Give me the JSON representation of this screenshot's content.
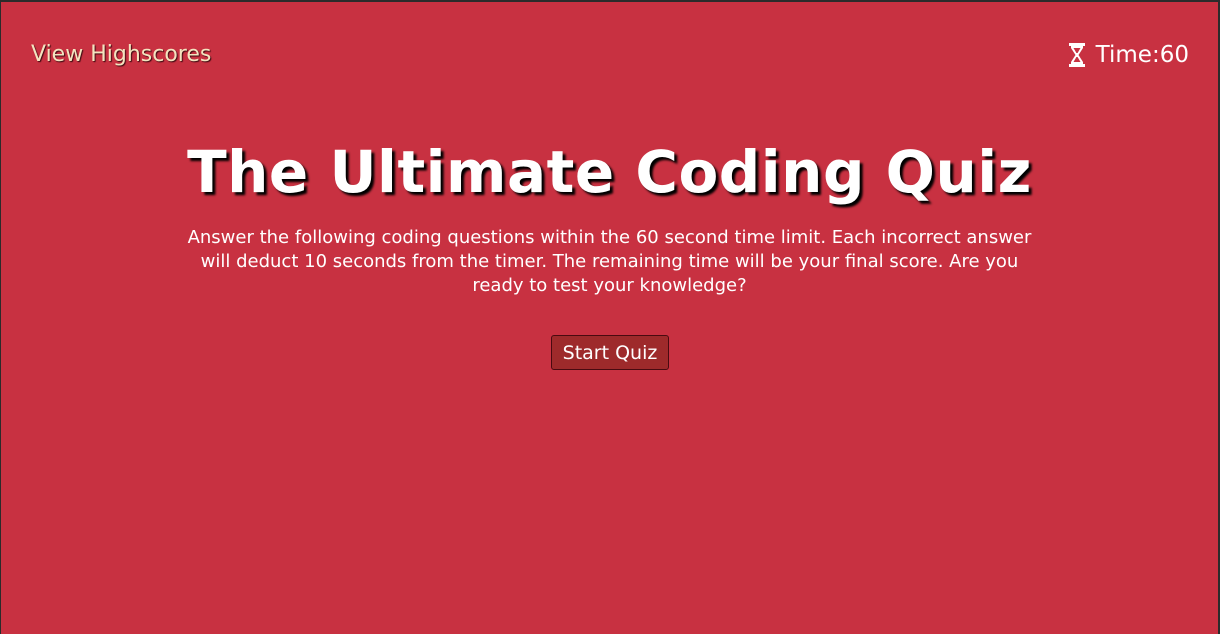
{
  "header": {
    "highscores_label": "View Highscores",
    "timer_label": "Time: ",
    "timer_value": "60",
    "timer_icon": "hourglass-icon"
  },
  "main": {
    "title": "The Ultimate Coding Quiz",
    "intro": "Answer the following coding questions within the 60 second time limit. Each incorrect answer will deduct 10 seconds from the timer. The remaining time will be your final score. Are you ready to test your knowledge?",
    "start_label": "Start Quiz"
  },
  "colors": {
    "background": "#c83141",
    "link": "#f4e4c0",
    "button": "#9e2a2b",
    "text": "#ffffff"
  }
}
